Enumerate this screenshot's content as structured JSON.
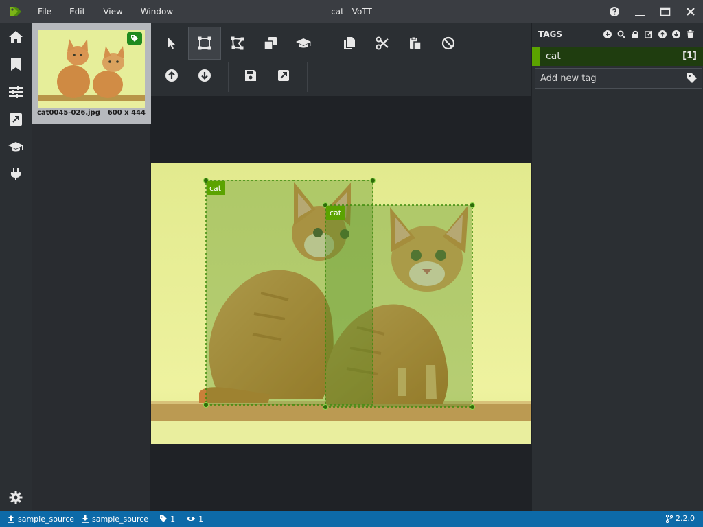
{
  "window": {
    "title": "cat - VoTT",
    "menu": [
      "File",
      "Edit",
      "View",
      "Window"
    ]
  },
  "nav": {
    "items": [
      "home-icon",
      "bookmark-icon",
      "sliders-icon",
      "export-icon",
      "graduation-cap-icon",
      "plug-icon"
    ],
    "settings": "gear-icon"
  },
  "thumbnails": [
    {
      "name": "cat0045-026.jpg",
      "size": "600 x 444",
      "tagged": true
    }
  ],
  "tags": {
    "title": "TAGS",
    "items": [
      {
        "name": "cat",
        "count": "[1]",
        "color": "#5ba300"
      }
    ],
    "input_placeholder": "Add new tag"
  },
  "regions": [
    {
      "label": "cat"
    },
    {
      "label": "cat"
    }
  ],
  "status": {
    "source": "sample_source",
    "target": "sample_source",
    "tagged_count": "1",
    "visited_count": "1",
    "version": "2.2.0"
  },
  "colors": {
    "accent": "#5ba300",
    "statusbar": "#0d6aa8"
  }
}
